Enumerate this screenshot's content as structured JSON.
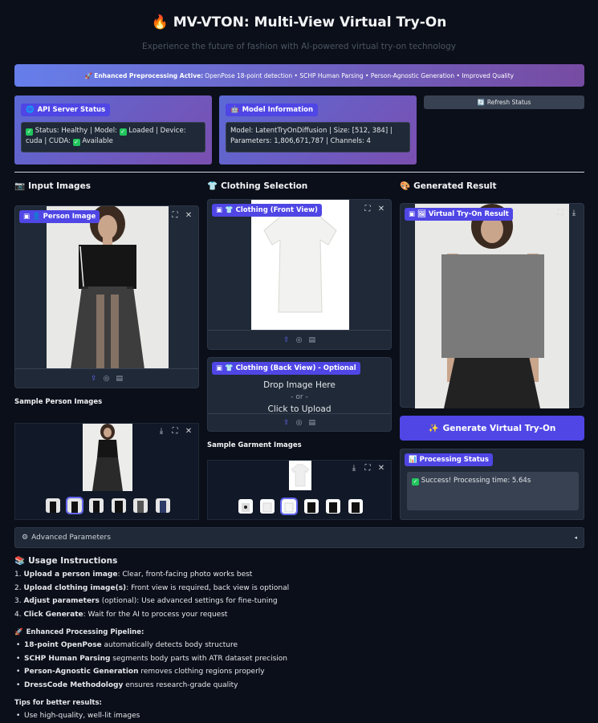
{
  "header": {
    "title": "MV-VTON: Multi-View Virtual Try-On",
    "subtitle": "Experience the future of fashion with AI-powered virtual try-on technology"
  },
  "banner": {
    "strong": "Enhanced Preprocessing Active:",
    "text": "OpenPose 18-point detection • SCHP Human Parsing • Person-Agnostic Generation • Improved Quality"
  },
  "api_status": {
    "label": "API Server Status",
    "line1_a": "Status: Healthy | Model:",
    "line1_b": "Loaded | Device:",
    "line2_a": "cuda | CUDA:",
    "line2_b": "Available"
  },
  "model_info": {
    "label": "Model Information",
    "line1": "Model: LatentTryOnDiffusion | Size: [512, 384] |",
    "line2": "Parameters: 1,806,671,787 | Channels: 4"
  },
  "refresh_button": "Refresh Status",
  "columns": {
    "input": "Input Images",
    "clothing": "Clothing Selection",
    "result": "Generated Result"
  },
  "person_image": {
    "label": "Person Image"
  },
  "clothing_front": {
    "label": "Clothing (Front View)"
  },
  "clothing_back": {
    "label": "Clothing (Back View) - Optional",
    "drop": "Drop Image Here",
    "or": "- or -",
    "click": "Click to Upload"
  },
  "result_image": {
    "label": "Virtual Try-On Result"
  },
  "sample_person_title": "Sample Person Images",
  "sample_garment_title": "Sample Garment Images",
  "generate_button": "Generate Virtual Try-On",
  "processing": {
    "label": "Processing Status",
    "text": "Success! Processing time: 5.64s"
  },
  "advanced": "Advanced Parameters",
  "instructions": {
    "title": "Usage Instructions",
    "steps": [
      {
        "strong": "Upload a person image",
        "text": ": Clear, front-facing photo works best"
      },
      {
        "strong": "Upload clothing image(s)",
        "text": ": Front view is required, back view is optional"
      },
      {
        "strong": "Adjust parameters",
        "text": " (optional): Use advanced settings for fine-tuning"
      },
      {
        "strong": "Click Generate",
        "text": ": Wait for the AI to process your request"
      }
    ],
    "pipeline_title": "Enhanced Processing Pipeline:",
    "pipeline": [
      {
        "strong": "18-point OpenPose",
        "text": " automatically detects body structure"
      },
      {
        "strong": "SCHP Human Parsing",
        "text": " segments body parts with ATR dataset precision"
      },
      {
        "strong": "Person-Agnostic Generation",
        "text": " removes clothing regions properly"
      },
      {
        "strong": "DressCode Methodology",
        "text": " ensures research-grade quality"
      }
    ],
    "tips_title": "Tips for better results:",
    "tips": [
      "Use high-quality, well-lit images"
    ]
  },
  "colors": {
    "accent": "#4f46e5",
    "background": "#0b0f19",
    "success": "#22c55e"
  }
}
